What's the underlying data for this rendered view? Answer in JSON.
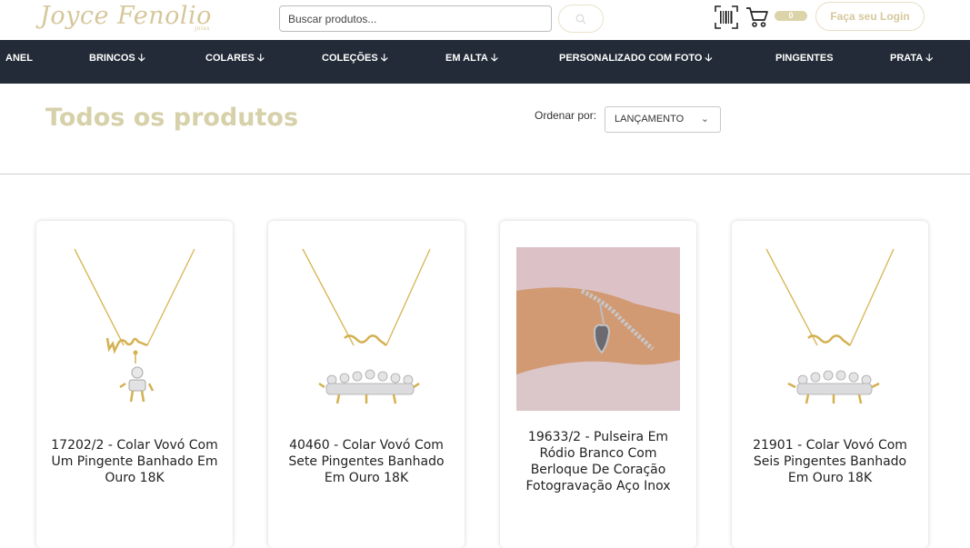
{
  "header": {
    "logo_text": "Joyce Fenolio",
    "logo_suffix": "joias",
    "search_placeholder": "Buscar produtos...",
    "cart_count": "0",
    "login_label": "Faça seu Login",
    "icons": {
      "search": "search-icon",
      "barcode": "barcode-icon",
      "cart": "cart-icon"
    }
  },
  "nav": {
    "items": [
      {
        "label": "ANEL",
        "arrow": ""
      },
      {
        "label": "BRINCOS",
        "arrow": "🡣"
      },
      {
        "label": "COLARES",
        "arrow": "🡣"
      },
      {
        "label": "COLEÇÕES",
        "arrow": "🡣"
      },
      {
        "label": "EM ALTA",
        "arrow": "🡣"
      },
      {
        "label": "PERSONALIZADO COM FOTO",
        "arrow": "🡣"
      },
      {
        "label": "PINGENTES",
        "arrow": ""
      },
      {
        "label": "PRATA",
        "arrow": "🡣"
      }
    ]
  },
  "page": {
    "title": "Todos os produtos",
    "sort_label": "Ordenar por:",
    "sort_value": "LANÇAMENTO"
  },
  "products": [
    {
      "title": "17202/2 - Colar Vovó Com Um Pingente Banhado Em Ouro 18K",
      "image": "gold-necklace-one-pendant"
    },
    {
      "title": "40460 - Colar Vovó Com Sete Pingentes Banhado Em Ouro 18K",
      "image": "gold-necklace-seven-pendants"
    },
    {
      "title": "19633/2 - Pulseira Em Ródio Branco Com Berloque De Coração Fotogravação Aço Inox",
      "image": "silver-bracelet-heart-photo"
    },
    {
      "title": "21901 - Colar Vovó Com Seis Pingentes Banhado Em Ouro 18K",
      "image": "gold-necklace-six-pendants"
    }
  ],
  "colors": {
    "brand_gold": "#d6c79b",
    "nav_bg": "#222b37",
    "title_color": "#d6d1aa"
  }
}
